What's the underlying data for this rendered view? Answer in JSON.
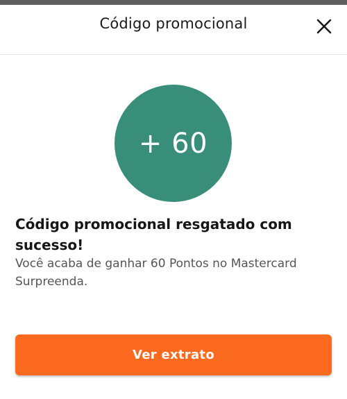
{
  "header": {
    "title": "Código promocional",
    "close_icon": "close-icon"
  },
  "reward": {
    "points_label": "+ 60",
    "circle_color": "#388e79"
  },
  "message": {
    "title": "Código promocional resgatado com sucesso!",
    "description": "Você acaba de ganhar 60 Pontos no Mastercard Surpreenda."
  },
  "actions": {
    "primary_label": "Ver extrato",
    "primary_color": "#fb6a1e"
  }
}
